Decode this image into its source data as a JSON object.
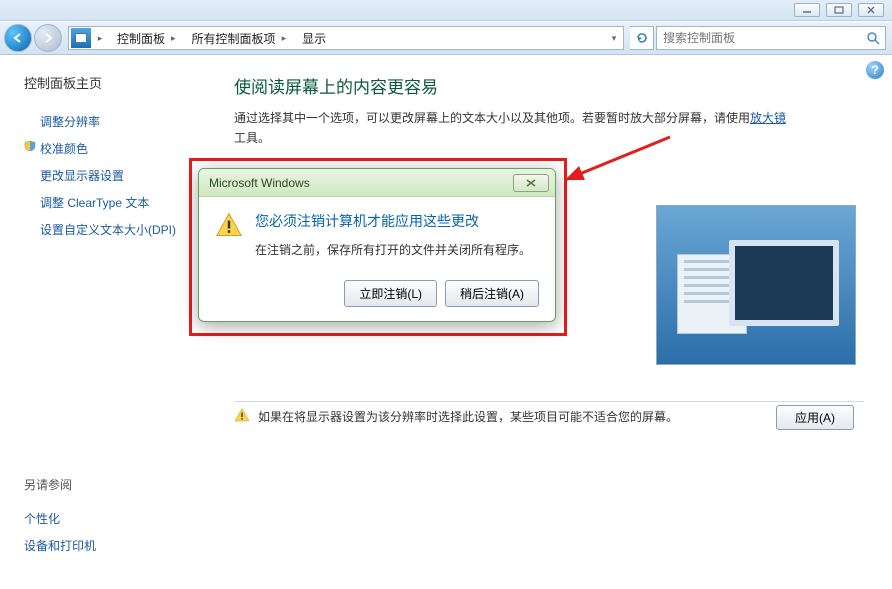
{
  "titlebar": {
    "min": "minimize",
    "max": "maximize",
    "close": "close"
  },
  "nav": {
    "crumb1": "控制面板",
    "crumb2": "所有控制面板项",
    "crumb3": "显示",
    "search_placeholder": "搜索控制面板"
  },
  "sidebar": {
    "home": "控制面板主页",
    "items": [
      "调整分辨率",
      "校准颜色",
      "更改显示器设置",
      "调整 ClearType 文本",
      "设置自定义文本大小(DPI)"
    ],
    "see_also_heading": "另请参阅",
    "see_also": [
      "个性化",
      "设备和打印机"
    ]
  },
  "main": {
    "heading": "使阅读屏幕上的内容更容易",
    "intro_pre": "通过选择其中一个选项，可以更改屏幕上的文本大小以及其他项。若要暂时放大部分屏幕，请使用",
    "intro_link": "放大镜",
    "intro_post": "工具。",
    "warn": "如果在将显示器设置为该分辨率时选择此设置，某些项目可能不适合您的屏幕。",
    "apply": "应用(A)"
  },
  "dialog": {
    "title": "Microsoft Windows",
    "msg_title": "您必须注销计算机才能应用这些更改",
    "msg_sub": "在注销之前，保存所有打开的文件并关闭所有程序。",
    "btn_now": "立即注销(L)",
    "btn_later": "稍后注销(A)"
  }
}
